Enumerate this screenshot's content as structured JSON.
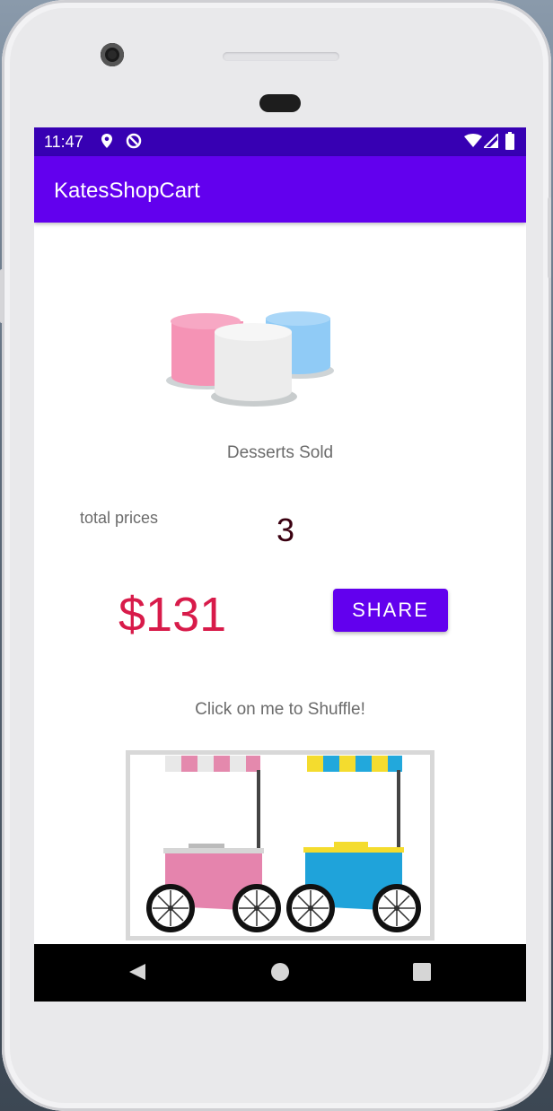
{
  "status_bar": {
    "time": "11:47",
    "icons": [
      "location-icon",
      "sync-icon",
      "wifi-icon",
      "signal-icon",
      "battery-icon"
    ]
  },
  "app_bar": {
    "title": "KatesShopCart"
  },
  "dessert": {
    "image_icon": "marshmallow-image",
    "sold_label": "Desserts Sold",
    "count": "3"
  },
  "totals": {
    "label": "total prices",
    "revenue": "$131"
  },
  "share_button": {
    "label": "SHARE"
  },
  "shuffle": {
    "label": "Click on me to Shuffle!",
    "image_icon": "dessert-carts-image"
  },
  "navigation": {
    "buttons": [
      "back-icon",
      "home-icon",
      "recents-icon"
    ]
  },
  "colors": {
    "status_bar": "#3700b3",
    "app_bar": "#6200ee",
    "accent": "#6200ee",
    "revenue_text": "#d81b4a",
    "count_text": "#3a0010"
  }
}
